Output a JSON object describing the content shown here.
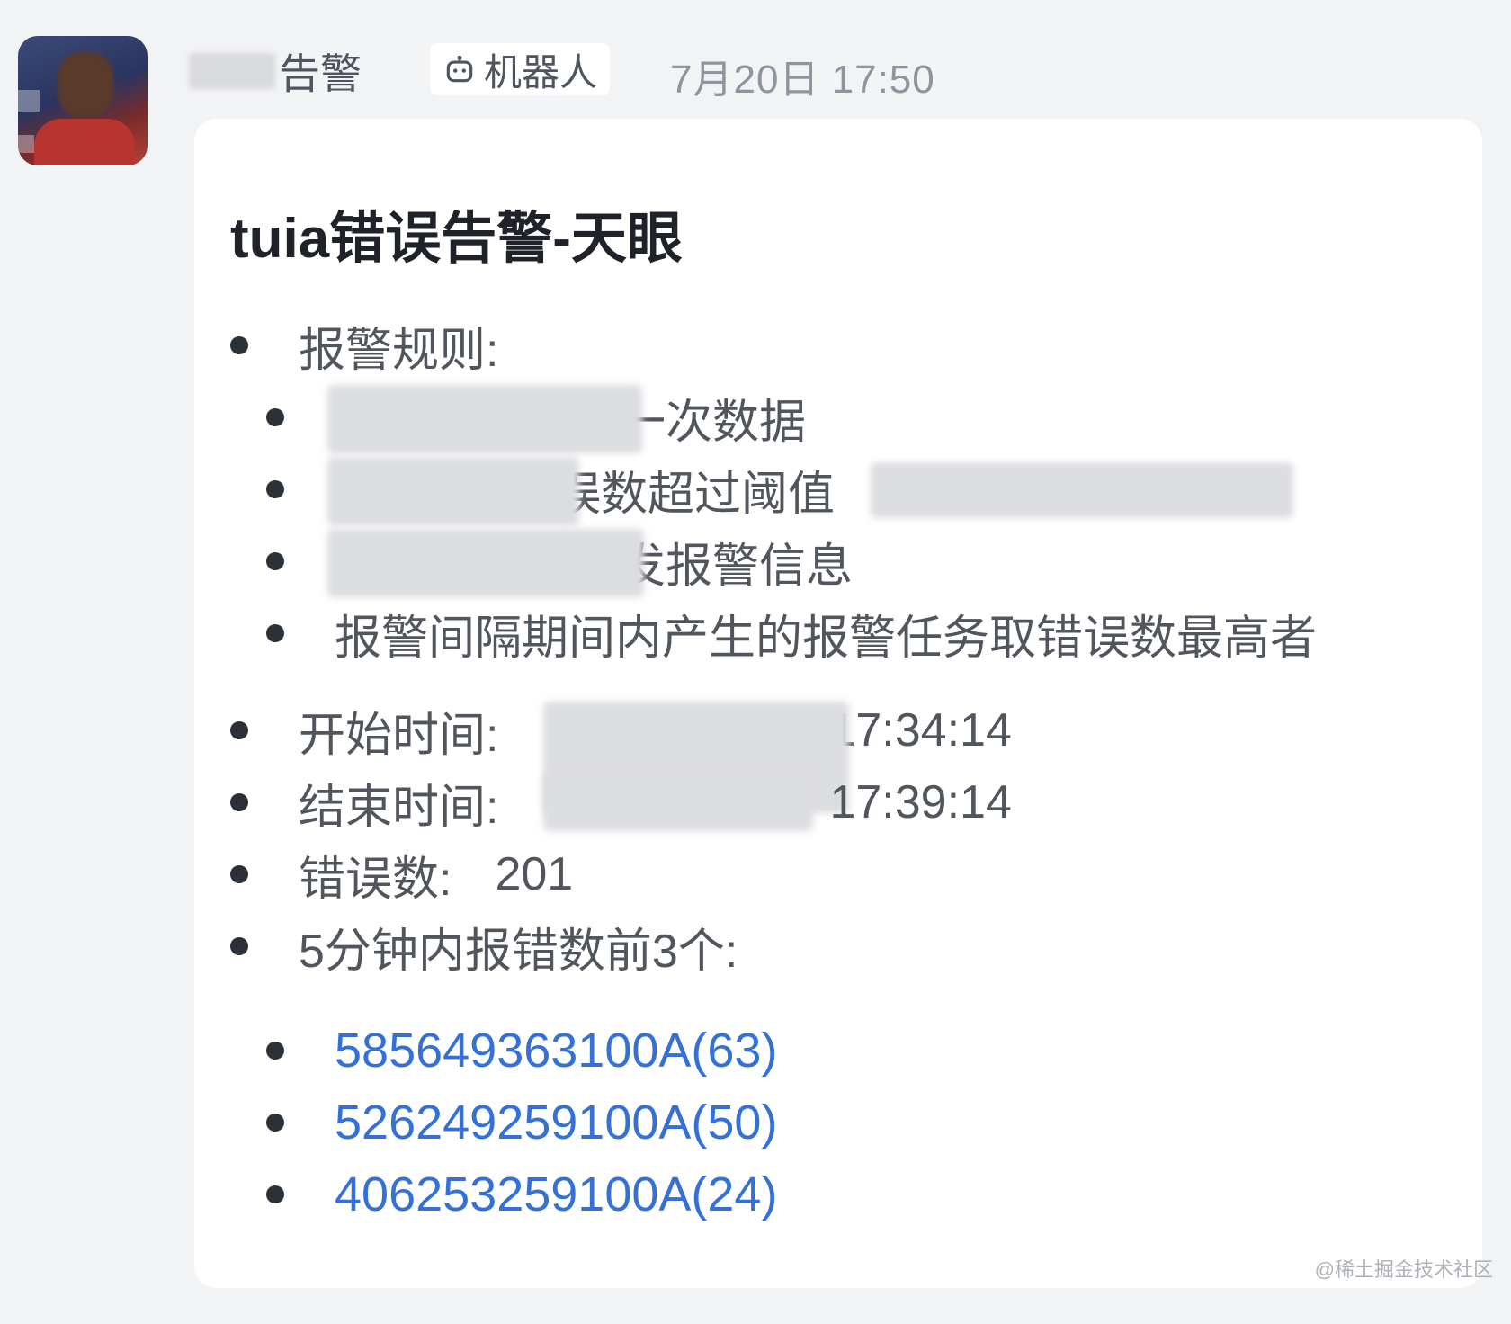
{
  "message": {
    "sender_name": "告警",
    "bot_tag": "机器人",
    "timestamp": "7月20日 17:50"
  },
  "card": {
    "title": "tuia错误告警-天眼",
    "rules_heading": "报警规则:",
    "rules": [
      "一次数据",
      "误数超过阈值",
      "发报警信息",
      "报警间隔期间内产生的报警任务取错误数最高者"
    ],
    "start_label": "开始时间:",
    "start_time_tail": "17:34:14",
    "end_label": "结束时间:",
    "end_time_tail": "17:39:14",
    "error_count_label": "错误数:",
    "error_count": "201",
    "top_errors_label": "5分钟内报错数前3个:",
    "top_errors": [
      "585649363100A(63)",
      "526249259100A(50)",
      "406253259100A(24)"
    ]
  },
  "watermark": "@稀土掘金技术社区",
  "icons": [
    "robot-icon",
    "bullet-icon"
  ],
  "colors": {
    "link": "#3370d8",
    "card_bg": "#ffffff",
    "page_bg": "#f2f3f5"
  }
}
